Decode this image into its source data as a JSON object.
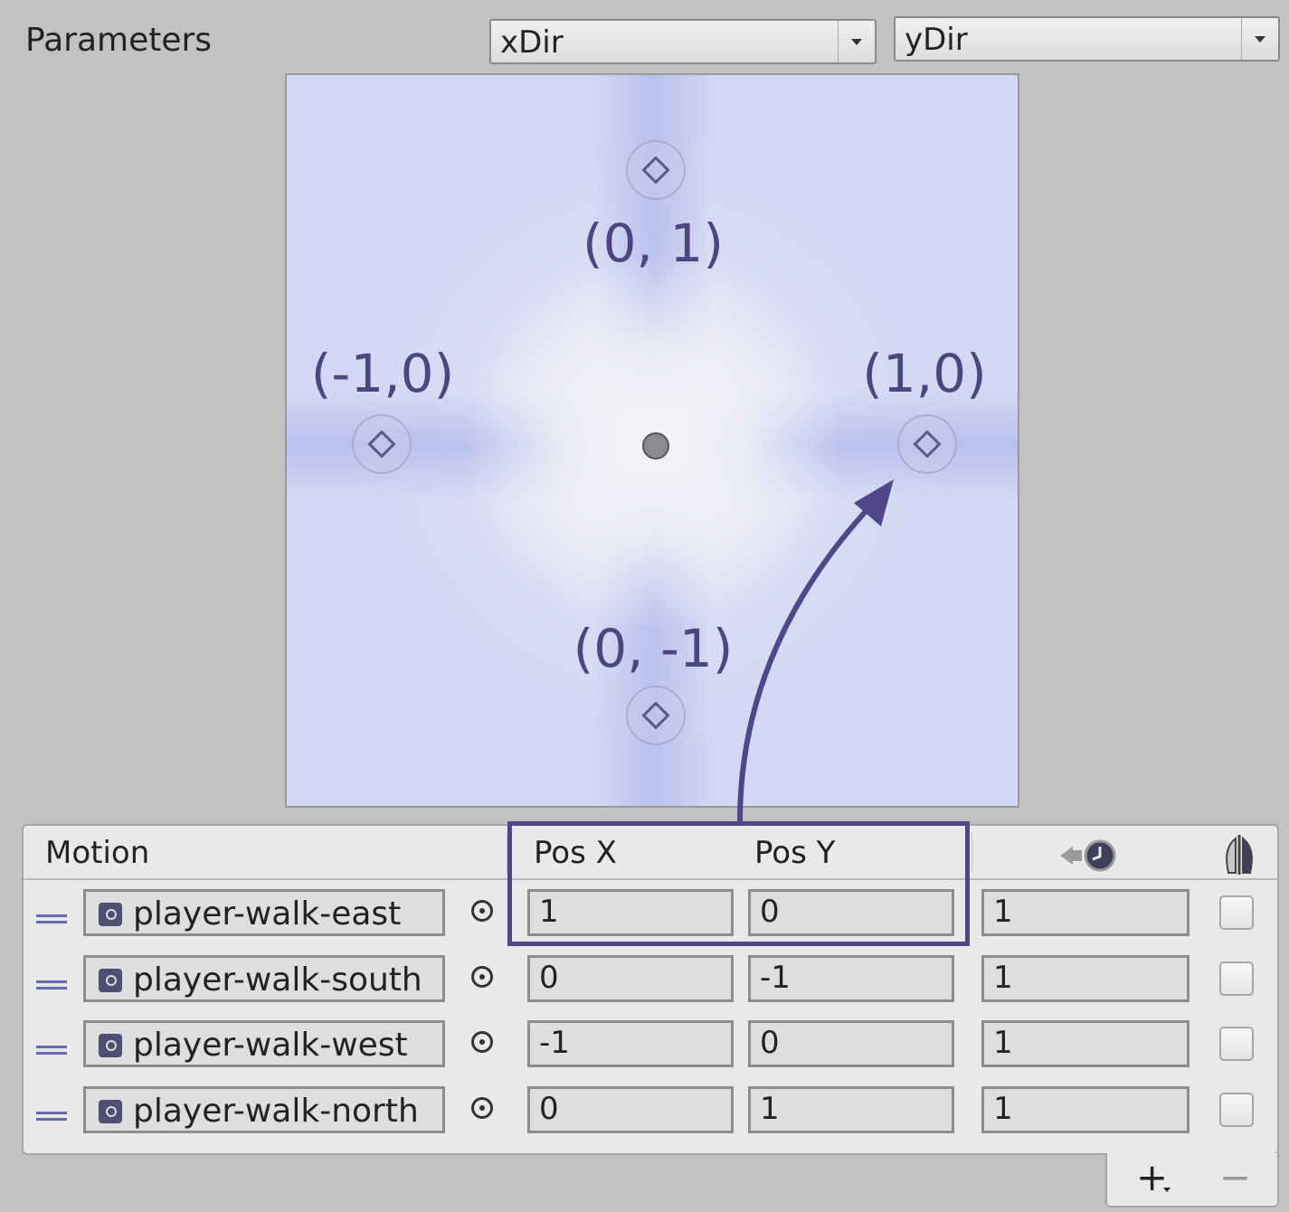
{
  "parameters": {
    "label": "Parameters",
    "x_param": "xDir",
    "y_param": "yDir"
  },
  "blend_tree": {
    "positions": [
      {
        "id": "north",
        "label": "(0, 1)"
      },
      {
        "id": "west",
        "label": "(-1,0)"
      },
      {
        "id": "east",
        "label": "(1,0)"
      },
      {
        "id": "south",
        "label": "(0, -1)"
      }
    ],
    "colors": {
      "background": "#d4d8f4",
      "label": "#4d467e",
      "arrow": "#4f4788"
    }
  },
  "motion_table": {
    "headers": {
      "motion": "Motion",
      "pos_x": "Pos X",
      "pos_y": "Pos Y"
    },
    "rows": [
      {
        "clip": "player-walk-east",
        "pos_x": "1",
        "pos_y": "0",
        "speed": "1"
      },
      {
        "clip": "player-walk-south",
        "pos_x": "0",
        "pos_y": "-1",
        "speed": "1"
      },
      {
        "clip": "player-walk-west",
        "pos_x": "-1",
        "pos_y": "0",
        "speed": "1"
      },
      {
        "clip": "player-walk-north",
        "pos_x": "0",
        "pos_y": "1",
        "speed": "1"
      }
    ],
    "footer": {
      "add": "+",
      "remove": "−"
    }
  },
  "icons": {
    "speed_header": "speed-clock-icon",
    "mirror_header": "mirror-icon",
    "drag_handle": "drag-handle-icon",
    "clip": "animation-clip-icon",
    "picker": "object-picker-icon"
  }
}
